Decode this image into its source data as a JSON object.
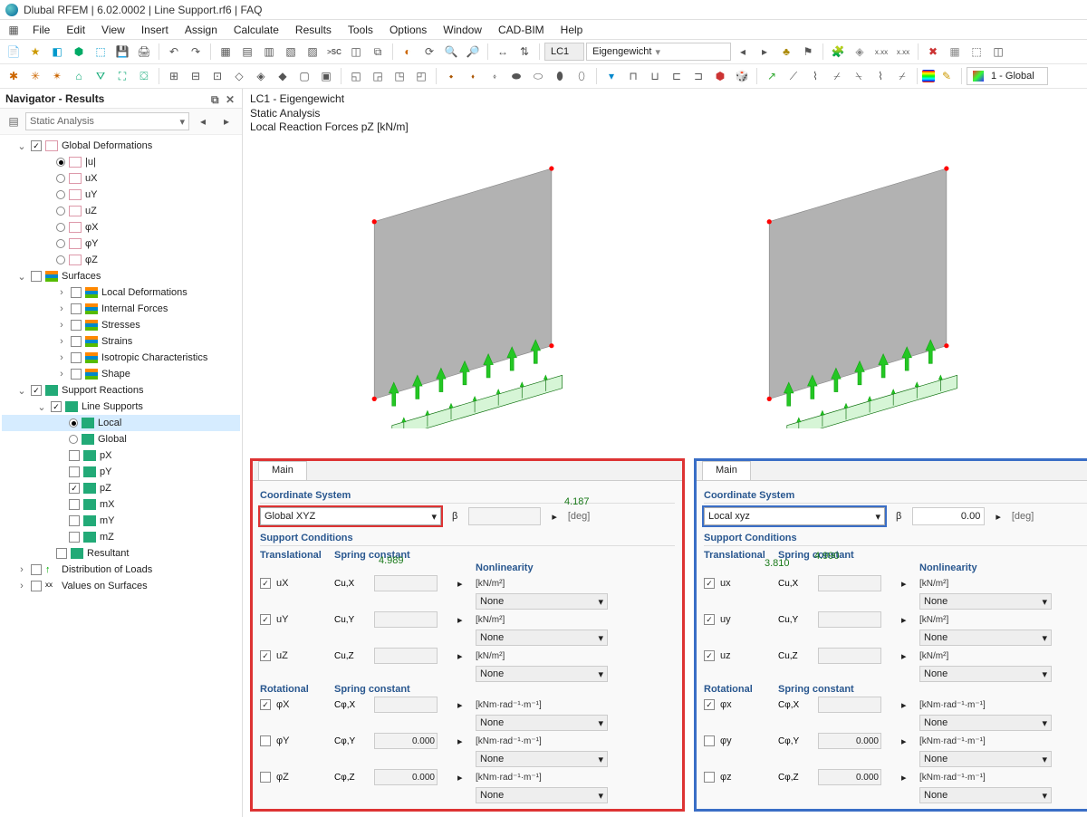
{
  "title": "Dlubal RFEM | 6.02.0002 | Line Support.rf6 | FAQ",
  "menus": [
    "File",
    "Edit",
    "View",
    "Insert",
    "Assign",
    "Calculate",
    "Results",
    "Tools",
    "Options",
    "Window",
    "CAD-BIM",
    "Help"
  ],
  "loadcase": {
    "code": "LC1",
    "name": "Eigengewicht"
  },
  "navigator": {
    "title": "Navigator - Results",
    "analysis_type": "Static Analysis",
    "tree": {
      "global_def": {
        "label": "Global Deformations",
        "checked": true,
        "items": [
          {
            "key": "u",
            "label": "|u|",
            "selected": true
          },
          {
            "key": "ux",
            "label": "uX"
          },
          {
            "key": "uy",
            "label": "uY"
          },
          {
            "key": "uz",
            "label": "uZ"
          },
          {
            "key": "phix",
            "label": "φX"
          },
          {
            "key": "phiy",
            "label": "φY"
          },
          {
            "key": "phiz",
            "label": "φZ"
          }
        ]
      },
      "surfaces": {
        "label": "Surfaces",
        "checked": false,
        "items": [
          {
            "label": "Local Deformations"
          },
          {
            "label": "Internal Forces"
          },
          {
            "label": "Stresses"
          },
          {
            "label": "Strains"
          },
          {
            "label": "Isotropic Characteristics"
          },
          {
            "label": "Shape"
          }
        ]
      },
      "support": {
        "label": "Support Reactions",
        "checked": true,
        "line_supports": {
          "label": "Line Supports",
          "checked": true,
          "sys": [
            {
              "key": "local",
              "label": "Local",
              "selected": true
            },
            {
              "key": "global",
              "label": "Global",
              "selected": false
            }
          ],
          "comps": [
            {
              "key": "px",
              "label": "pX",
              "checked": false
            },
            {
              "key": "py",
              "label": "pY",
              "checked": false
            },
            {
              "key": "pz",
              "label": "pZ",
              "checked": true
            },
            {
              "key": "mx",
              "label": "mX",
              "checked": false
            },
            {
              "key": "my",
              "label": "mY",
              "checked": false
            },
            {
              "key": "mz",
              "label": "mZ",
              "checked": false
            }
          ]
        },
        "resultant": {
          "label": "Resultant",
          "checked": false
        }
      },
      "dist_loads": {
        "label": "Distribution of Loads"
      },
      "values": {
        "label": "Values on Surfaces",
        "icon": "xx"
      }
    }
  },
  "viewhdr": {
    "line1": "LC1 - Eigengewicht",
    "line2": "Static Analysis",
    "line3": "Local Reaction Forces pZ [kN/m]"
  },
  "values_left": {
    "left": "4.989",
    "right": "4.187"
  },
  "values_right": {
    "left": "3.810",
    "mid": "4.990"
  },
  "coord_label": "1 - Global",
  "panel": {
    "tab": "Main",
    "cs_label": "Coordinate System",
    "beta_label": "β",
    "deg": "[deg]",
    "sc_label": "Support Conditions",
    "trans": "Translational",
    "rot": "Rotational",
    "spring": "Spring constant",
    "nonl": "Nonlinearity",
    "none": "None",
    "val0": "0.000",
    "beta0": "0.00",
    "c_ux": "Cu,X",
    "c_uy": "Cu,Y",
    "c_uz": "Cu,Z",
    "c_fx": "Cφ,X",
    "c_fy": "Cφ,Y",
    "c_fz": "Cφ,Z",
    "u_lin": "[kN/m²]",
    "u_rot": "[kNm·rad⁻¹·m⁻¹]",
    "left": {
      "cs": "Global XYZ",
      "trans": [
        {
          "l": "uX",
          "on": true
        },
        {
          "l": "uY",
          "on": true
        },
        {
          "l": "uZ",
          "on": true
        }
      ],
      "rot": [
        {
          "l": "φX",
          "on": true,
          "v": ""
        },
        {
          "l": "φY",
          "on": false,
          "v": "0.000"
        },
        {
          "l": "φZ",
          "on": false,
          "v": "0.000"
        }
      ]
    },
    "right": {
      "cs": "Local xyz",
      "trans": [
        {
          "l": "ux",
          "on": true
        },
        {
          "l": "uy",
          "on": true
        },
        {
          "l": "uz",
          "on": true
        }
      ],
      "rot": [
        {
          "l": "φx",
          "on": true,
          "v": ""
        },
        {
          "l": "φy",
          "on": false,
          "v": "0.000"
        },
        {
          "l": "φz",
          "on": false,
          "v": "0.000"
        }
      ]
    }
  }
}
